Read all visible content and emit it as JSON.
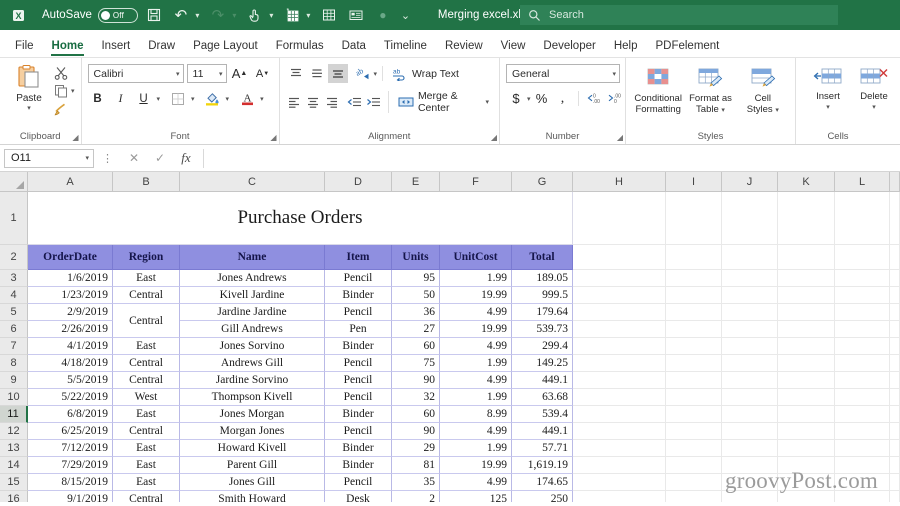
{
  "titlebar": {
    "autosave_label": "AutoSave",
    "autosave_state": "Off",
    "document_title": "Merging excel.xlsx",
    "quick_access": [
      {
        "name": "save-icon",
        "glyph": "Ὃe"
      },
      {
        "name": "undo-icon",
        "glyph": "↶"
      },
      {
        "name": "redo-icon",
        "glyph": "↷"
      },
      {
        "name": "touch-mode-icon",
        "glyph": "☝"
      },
      {
        "name": "new-sheet-icon",
        "glyph": "▦"
      },
      {
        "name": "table-icon",
        "glyph": "▤"
      },
      {
        "name": "form-icon",
        "glyph": "▥"
      },
      {
        "name": "record-icon",
        "glyph": "●"
      },
      {
        "name": "customize-toolbar-icon",
        "glyph": "⌄"
      }
    ],
    "search_placeholder": "Search",
    "search_icon": "search-icon"
  },
  "tabs": [
    {
      "label": "File",
      "active": false
    },
    {
      "label": "Home",
      "active": true
    },
    {
      "label": "Insert",
      "active": false
    },
    {
      "label": "Draw",
      "active": false
    },
    {
      "label": "Page Layout",
      "active": false
    },
    {
      "label": "Formulas",
      "active": false
    },
    {
      "label": "Data",
      "active": false
    },
    {
      "label": "Timeline",
      "active": false
    },
    {
      "label": "Review",
      "active": false
    },
    {
      "label": "View",
      "active": false
    },
    {
      "label": "Developer",
      "active": false
    },
    {
      "label": "Help",
      "active": false
    },
    {
      "label": "PDFelement",
      "active": false
    }
  ],
  "ribbon": {
    "clipboard": {
      "group_label": "Clipboard",
      "paste_label": "Paste",
      "cut_label": "Cut",
      "copy_label": "Copy",
      "format_painter_label": "Format Painter"
    },
    "font": {
      "group_label": "Font",
      "font_name": "Calibri",
      "font_size": "11",
      "grow_font": "A",
      "shrink_font": "A",
      "bold": "B",
      "italic": "I",
      "underline": "U",
      "borders": "borders",
      "fill_color": "fill-color",
      "font_color": "A"
    },
    "alignment": {
      "group_label": "Alignment",
      "wrap_text_label": "Wrap Text",
      "merge_center_label": "Merge & Center",
      "orientation": "orientation",
      "decrease_indent": "decrease-indent",
      "increase_indent": "increase-indent"
    },
    "number": {
      "group_label": "Number",
      "format_value": "General",
      "accounting": "$",
      "percent": "%",
      "comma": ",",
      "increase_decimal": ".00",
      "decrease_decimal": ".00"
    },
    "styles": {
      "group_label": "Styles",
      "conditional_formatting": "Conditional\nFormatting",
      "conditional_formatting_l1": "Conditional",
      "conditional_formatting_l2": "Formatting",
      "format_as_table_l1": "Format as",
      "format_as_table_l2": "Table",
      "cell_styles_l1": "Cell",
      "cell_styles_l2": "Styles"
    },
    "cells": {
      "group_label": "Cells",
      "insert_label": "Insert",
      "delete_label": "Delete"
    }
  },
  "formula_bar": {
    "name_box_value": "O11",
    "cancel_icon": "cancel-icon",
    "enter_icon": "check-icon",
    "function_icon": "fx-icon",
    "formula_value": ""
  },
  "grid": {
    "column_headers": [
      "A",
      "B",
      "C",
      "D",
      "E",
      "F",
      "G",
      "H",
      "I",
      "J",
      "K",
      "L"
    ],
    "row_headers": [
      "1",
      "2",
      "3",
      "4",
      "5",
      "6",
      "7",
      "8",
      "9",
      "10",
      "11",
      "12",
      "13",
      "14",
      "15",
      "16"
    ],
    "selected_row": "11",
    "merged_title": "Purchase Orders",
    "table_headers": [
      "OrderDate",
      "Region",
      "Name",
      "Item",
      "Units",
      "UnitCost",
      "Total"
    ],
    "merged_region_value": "Central",
    "rows": [
      {
        "row": "3",
        "OrderDate": "1/6/2019",
        "Region": "East",
        "Name": "Jones Andrews",
        "Item": "Pencil",
        "Units": "95",
        "UnitCost": "1.99",
        "Total": "189.05"
      },
      {
        "row": "4",
        "OrderDate": "1/23/2019",
        "Region": "Central",
        "Name": "Kivell Jardine",
        "Item": "Binder",
        "Units": "50",
        "UnitCost": "19.99",
        "Total": "999.5"
      },
      {
        "row": "5",
        "OrderDate": "2/9/2019",
        "Region": "",
        "Name": "Jardine Jardine",
        "Item": "Pencil",
        "Units": "36",
        "UnitCost": "4.99",
        "Total": "179.64"
      },
      {
        "row": "6",
        "OrderDate": "2/26/2019",
        "Region": "",
        "Name": "Gill Andrews",
        "Item": "Pen",
        "Units": "27",
        "UnitCost": "19.99",
        "Total": "539.73"
      },
      {
        "row": "7",
        "OrderDate": "4/1/2019",
        "Region": "East",
        "Name": "Jones Sorvino",
        "Item": "Binder",
        "Units": "60",
        "UnitCost": "4.99",
        "Total": "299.4"
      },
      {
        "row": "8",
        "OrderDate": "4/18/2019",
        "Region": "Central",
        "Name": "Andrews Gill",
        "Item": "Pencil",
        "Units": "75",
        "UnitCost": "1.99",
        "Total": "149.25"
      },
      {
        "row": "9",
        "OrderDate": "5/5/2019",
        "Region": "Central",
        "Name": "Jardine Sorvino",
        "Item": "Pencil",
        "Units": "90",
        "UnitCost": "4.99",
        "Total": "449.1"
      },
      {
        "row": "10",
        "OrderDate": "5/22/2019",
        "Region": "West",
        "Name": "Thompson Kivell",
        "Item": "Pencil",
        "Units": "32",
        "UnitCost": "1.99",
        "Total": "63.68"
      },
      {
        "row": "11",
        "OrderDate": "6/8/2019",
        "Region": "East",
        "Name": "Jones Morgan",
        "Item": "Binder",
        "Units": "60",
        "UnitCost": "8.99",
        "Total": "539.4"
      },
      {
        "row": "12",
        "OrderDate": "6/25/2019",
        "Region": "Central",
        "Name": "Morgan Jones",
        "Item": "Pencil",
        "Units": "90",
        "UnitCost": "4.99",
        "Total": "449.1"
      },
      {
        "row": "13",
        "OrderDate": "7/12/2019",
        "Region": "East",
        "Name": "Howard Kivell",
        "Item": "Binder",
        "Units": "29",
        "UnitCost": "1.99",
        "Total": "57.71"
      },
      {
        "row": "14",
        "OrderDate": "7/29/2019",
        "Region": "East",
        "Name": "Parent Gill",
        "Item": "Binder",
        "Units": "81",
        "UnitCost": "19.99",
        "Total": "1,619.19"
      },
      {
        "row": "15",
        "OrderDate": "8/15/2019",
        "Region": "East",
        "Name": "Jones Gill",
        "Item": "Pencil",
        "Units": "35",
        "UnitCost": "4.99",
        "Total": "174.65"
      },
      {
        "row": "16",
        "OrderDate": "9/1/2019",
        "Region": "Central",
        "Name": "Smith Howard",
        "Item": "Desk",
        "Units": "2",
        "UnitCost": "125",
        "Total": "250"
      }
    ]
  },
  "watermark": "groovyPost.com",
  "colors": {
    "excel_green": "#217346",
    "table_header_bg": "#8f8fe0",
    "table_header_text": "#15154a",
    "selection_green": "#217346",
    "row_header_bg": "#eaeaea"
  }
}
